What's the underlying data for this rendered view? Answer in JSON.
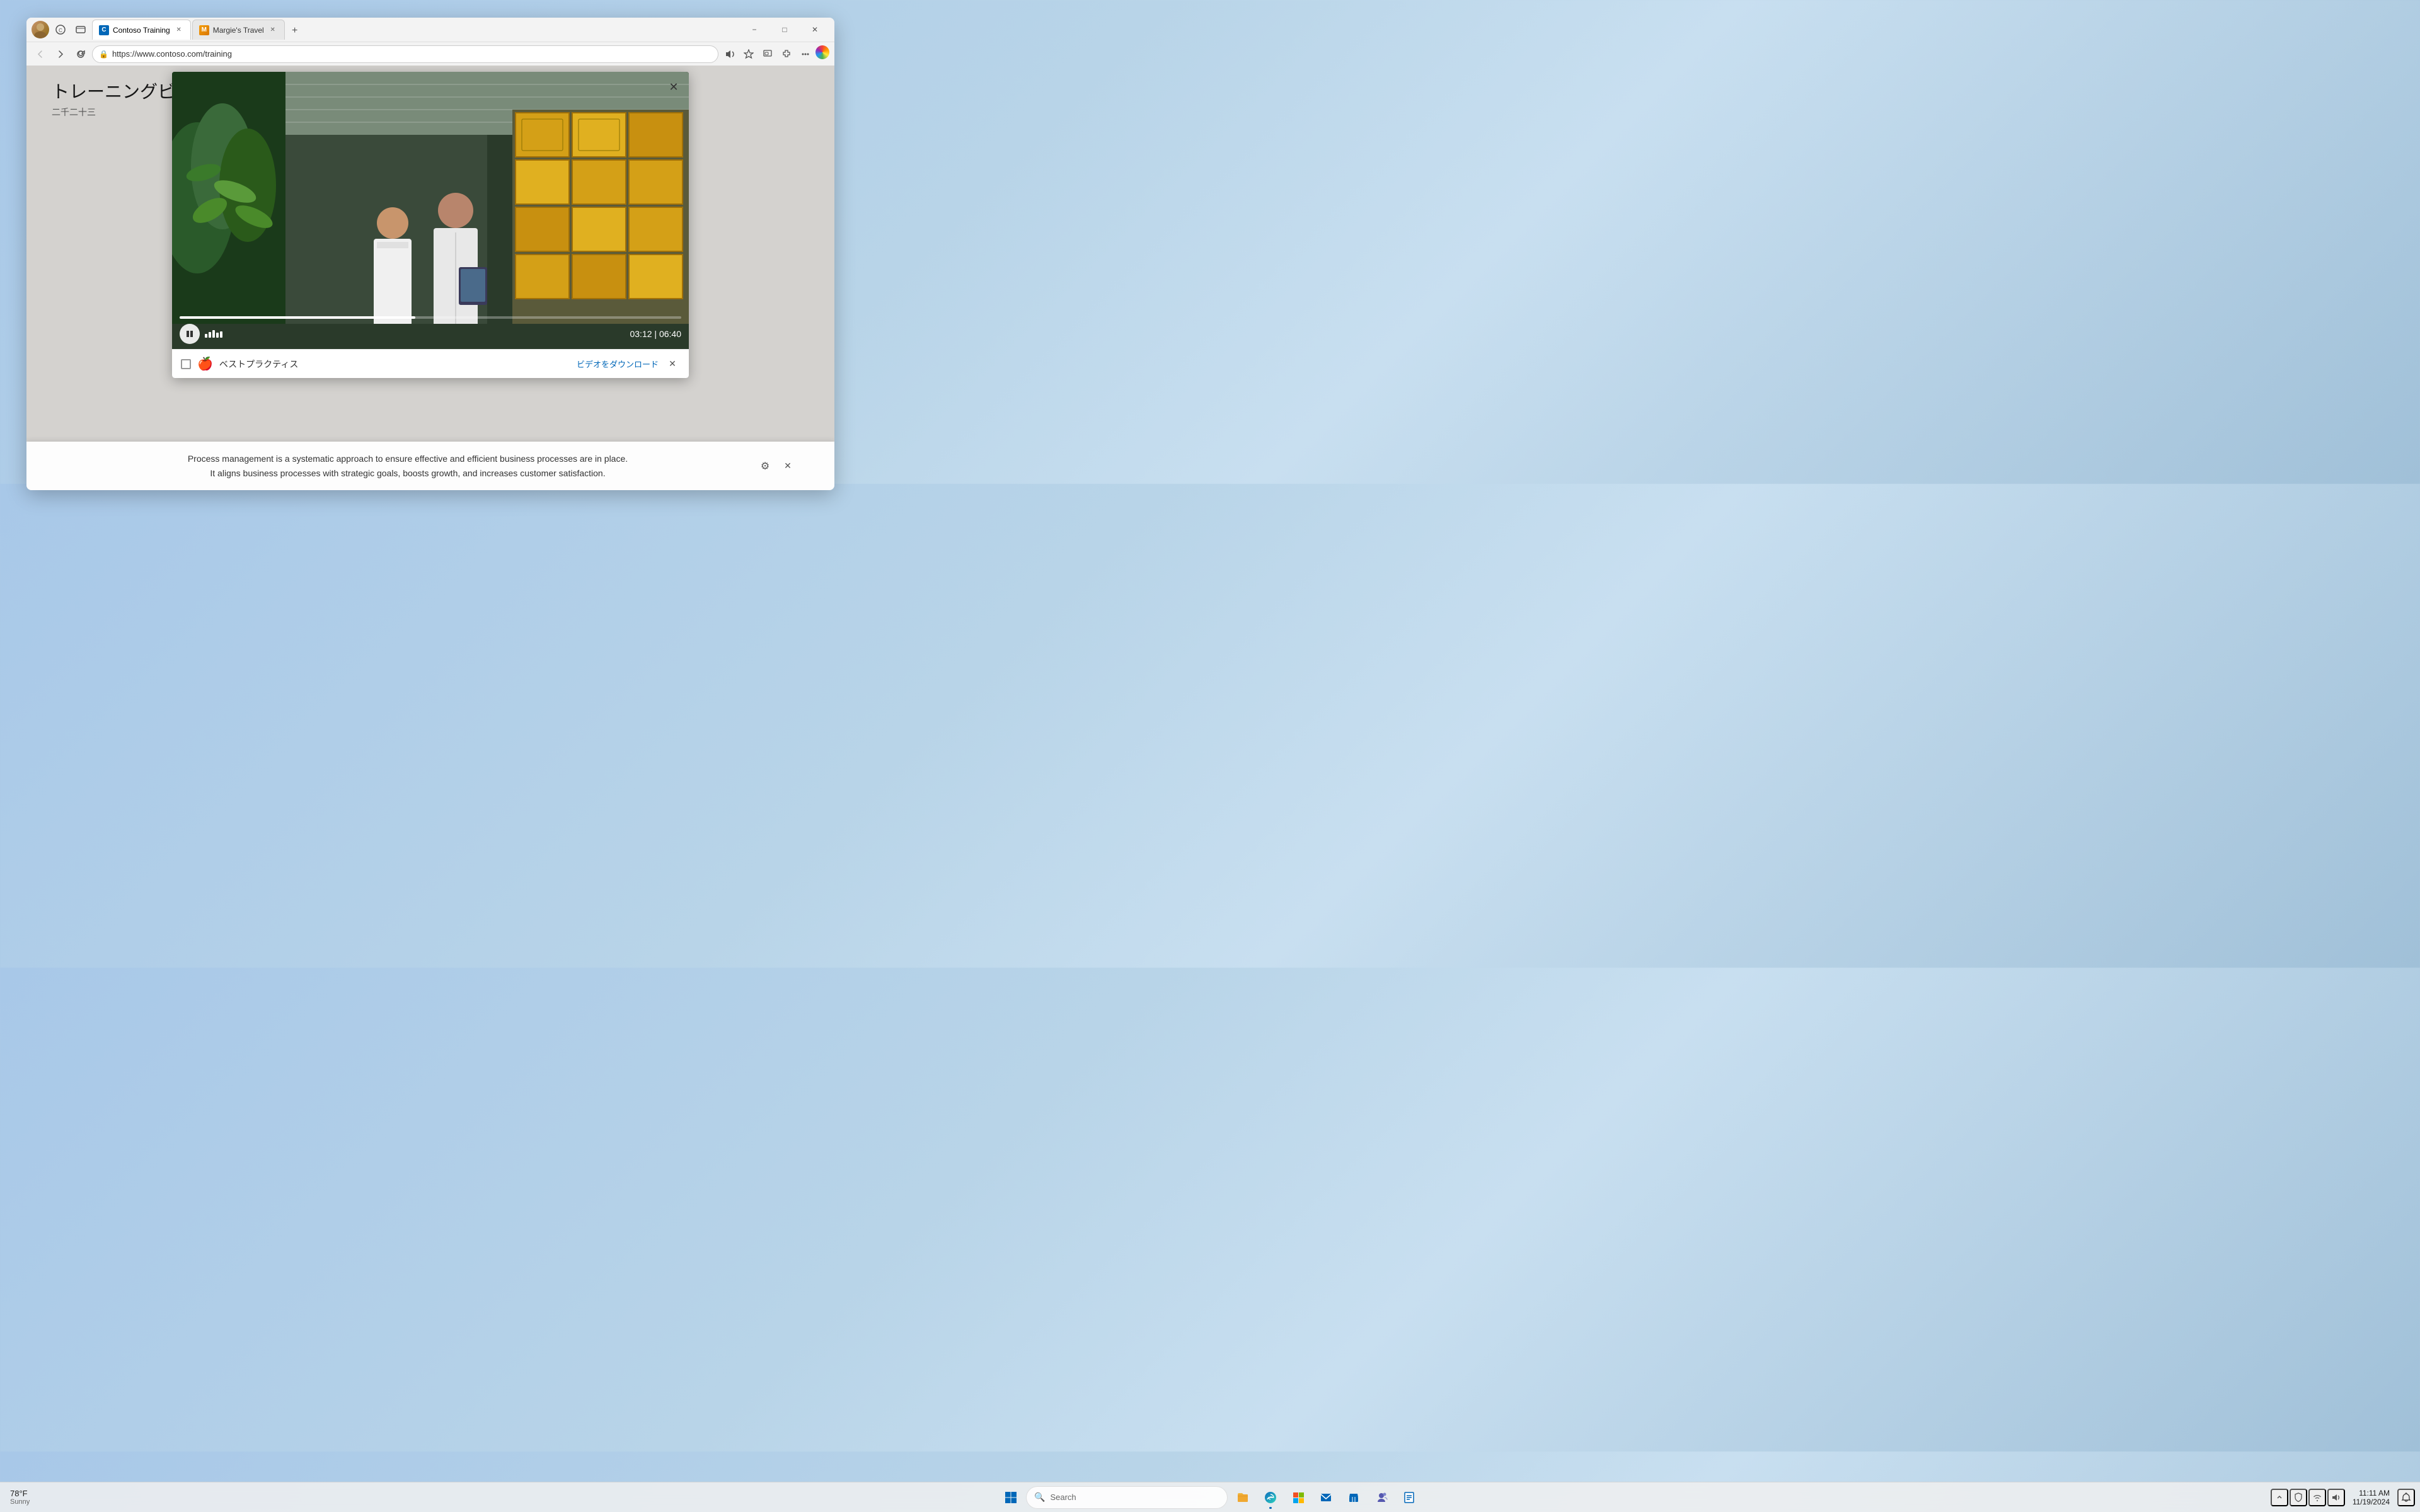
{
  "browser": {
    "tabs": [
      {
        "id": "tab-contoso",
        "label": "Contoso Training",
        "url": "https://www.contoso.com/training",
        "active": true,
        "favicon": "contoso"
      },
      {
        "id": "tab-margie",
        "label": "Margie's Travel",
        "active": false,
        "favicon": "margie"
      }
    ],
    "url": "https://www.contoso.com/training",
    "new_tab_label": "+",
    "minimize": "−",
    "maximize": "□",
    "close": "✕"
  },
  "page": {
    "title": "トレーニングビデオ",
    "subtitle": "二千二十三"
  },
  "video": {
    "current_time": "03:12",
    "total_time": "06:40",
    "progress_percent": 47,
    "is_playing": true,
    "notification": {
      "text": "ベストプラクティス",
      "download_label": "ビデオをダウンロード"
    }
  },
  "description": {
    "text": "Process management is a systematic approach to ensure effective and efficient business processes are in place.\nIt aligns business processes with strategic goals, boosts growth, and increases customer satisfaction."
  },
  "taskbar": {
    "weather": {
      "temp": "78°F",
      "condition": "Sunny"
    },
    "search_placeholder": "Search",
    "clock": {
      "time": "11:11 AM",
      "date": "11/19/2024"
    },
    "icons": [
      {
        "name": "file-explorer",
        "symbol": "📁",
        "active": false
      },
      {
        "name": "edge-browser",
        "symbol": "edge",
        "active": true
      },
      {
        "name": "msn",
        "symbol": "🌐",
        "active": false
      },
      {
        "name": "mail",
        "symbol": "✉",
        "active": false
      },
      {
        "name": "store",
        "symbol": "🛍",
        "active": false
      },
      {
        "name": "teams",
        "symbol": "teams",
        "active": false
      },
      {
        "name": "task",
        "symbol": "💼",
        "active": false
      }
    ],
    "tray": {
      "chevron": "^",
      "security": "🛡",
      "network": "wifi",
      "volume": "🔊",
      "notification": "🔔"
    }
  }
}
